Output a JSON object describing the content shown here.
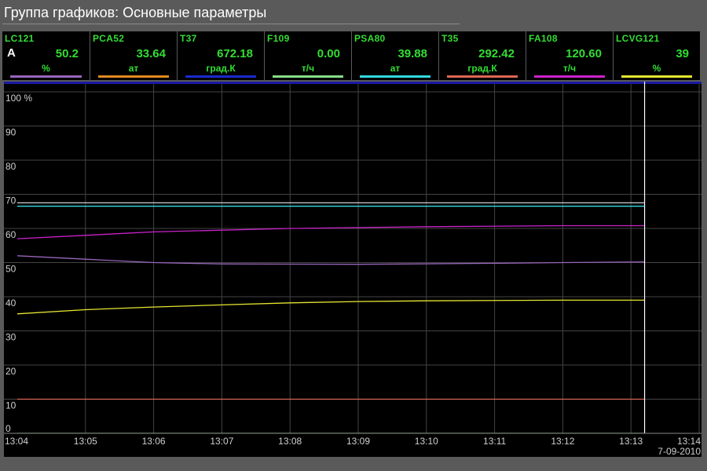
{
  "window": {
    "title": "Группа графиков: Основные параметры"
  },
  "tags": [
    {
      "name": "LC121",
      "mode": "A",
      "value": "50.2",
      "unit": "%",
      "color": "#9966bb"
    },
    {
      "name": "PCA52",
      "mode": "",
      "value": "33.64",
      "unit": "ат",
      "color": "#e08a1e"
    },
    {
      "name": "T37",
      "mode": "",
      "value": "672.18",
      "unit": "град.К",
      "color": "#1a2acc"
    },
    {
      "name": "F109",
      "mode": "",
      "value": "0.00",
      "unit": "т/ч",
      "color": "#88dd88"
    },
    {
      "name": "PSA80",
      "mode": "",
      "value": "39.88",
      "unit": "ат",
      "color": "#33d9e0"
    },
    {
      "name": "T35",
      "mode": "",
      "value": "292.42",
      "unit": "град.К",
      "color": "#dd6655"
    },
    {
      "name": "FA108",
      "mode": "",
      "value": "120.60",
      "unit": "т/ч",
      "color": "#cc22cc"
    },
    {
      "name": "LCVG121",
      "mode": "",
      "value": "39",
      "unit": "%",
      "color": "#e6e632"
    }
  ],
  "chart_data": {
    "type": "line",
    "ylabel": "%",
    "ylim": [
      0,
      100
    ],
    "yticks": [
      {
        "value": 100,
        "label": "100 %"
      },
      {
        "value": 90,
        "label": "90"
      },
      {
        "value": 80,
        "label": "80"
      },
      {
        "value": 70,
        "label": "70"
      },
      {
        "value": 60,
        "label": "60"
      },
      {
        "value": 50,
        "label": "50"
      },
      {
        "value": 40,
        "label": "40"
      },
      {
        "value": 30,
        "label": "30"
      },
      {
        "value": 20,
        "label": "20"
      },
      {
        "value": 10,
        "label": "10"
      },
      {
        "value": 0,
        "label": "0"
      }
    ],
    "xlim": [
      "13:04",
      "13:14"
    ],
    "xticks": [
      "13:04",
      "13:05",
      "13:06",
      "13:07",
      "13:08",
      "13:09",
      "13:10",
      "13:11",
      "13:12",
      "13:13",
      "13:14"
    ],
    "date": "7-09-2010",
    "cursor": "13:13.2",
    "grid": true,
    "series": [
      {
        "color": "#33d9e0",
        "x": [
          "13:04",
          "13:13.2"
        ],
        "y": [
          66.5,
          66.5
        ]
      },
      {
        "color": "#cfcfcf",
        "x": [
          "13:04",
          "13:13.2"
        ],
        "y": [
          67.5,
          67.5
        ]
      },
      {
        "color": "#cc22cc",
        "x": [
          "13:04",
          "13:06",
          "13:08",
          "13:10",
          "13:12",
          "13:13.2"
        ],
        "y": [
          57,
          59,
          60,
          60.5,
          60.8,
          60.8
        ]
      },
      {
        "color": "#9966bb",
        "x": [
          "13:04",
          "13:05",
          "13:06",
          "13:07",
          "13:09",
          "13:11",
          "13:12",
          "13:13.2"
        ],
        "y": [
          52,
          51,
          50,
          49.6,
          49.5,
          49.8,
          50,
          50.2
        ]
      },
      {
        "color": "#e6e632",
        "x": [
          "13:04",
          "13:05",
          "13:06",
          "13:07",
          "13:08",
          "13:09",
          "13:10",
          "13:12",
          "13:13.2"
        ],
        "y": [
          35,
          36.2,
          37,
          37.6,
          38.2,
          38.6,
          38.8,
          39,
          39
        ]
      },
      {
        "color": "#dd6655",
        "x": [
          "13:04",
          "13:13.2"
        ],
        "y": [
          10,
          10
        ],
        "label": ""
      },
      {
        "color": "#88dd88",
        "x": [
          "13:04",
          "13:13.2"
        ],
        "y": [
          0,
          0
        ]
      }
    ]
  }
}
